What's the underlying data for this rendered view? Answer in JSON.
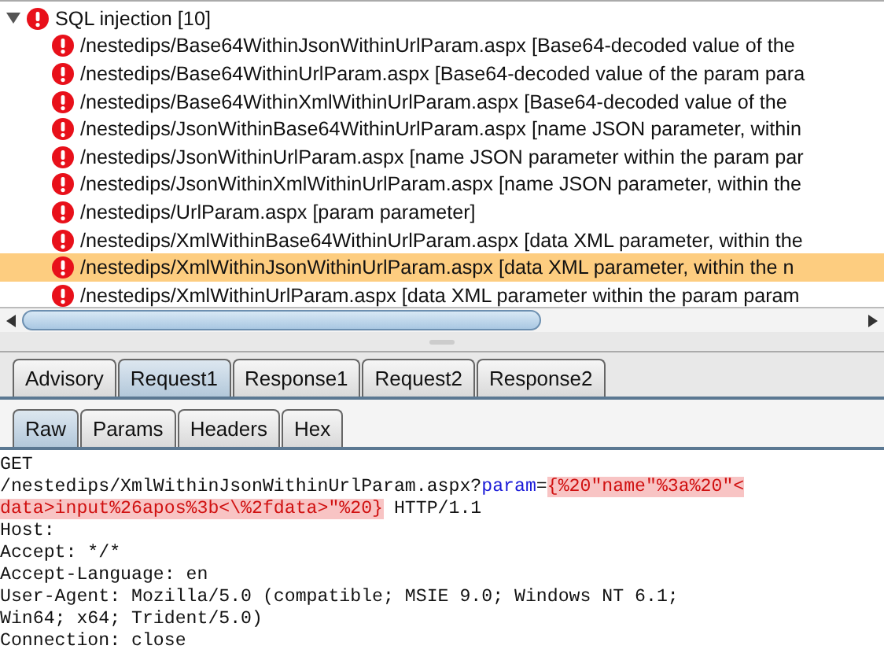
{
  "tree": {
    "label": "SQL injection [10]",
    "expanded": true,
    "children": [
      {
        "label": "/nestedips/Base64WithinJsonWithinUrlParam.aspx [Base64-decoded value of the",
        "selected": false
      },
      {
        "label": "/nestedips/Base64WithinUrlParam.aspx [Base64-decoded value of the param para",
        "selected": false
      },
      {
        "label": "/nestedips/Base64WithinXmlWithinUrlParam.aspx [Base64-decoded value of the",
        "selected": false
      },
      {
        "label": "/nestedips/JsonWithinBase64WithinUrlParam.aspx [name JSON parameter, within",
        "selected": false
      },
      {
        "label": "/nestedips/JsonWithinUrlParam.aspx [name JSON parameter within the param par",
        "selected": false
      },
      {
        "label": "/nestedips/JsonWithinXmlWithinUrlParam.aspx [name JSON parameter, within the",
        "selected": false
      },
      {
        "label": "/nestedips/UrlParam.aspx [param parameter]",
        "selected": false
      },
      {
        "label": "/nestedips/XmlWithinBase64WithinUrlParam.aspx [data XML parameter, within the",
        "selected": false
      },
      {
        "label": "/nestedips/XmlWithinJsonWithinUrlParam.aspx [data XML parameter, within the n",
        "selected": true
      },
      {
        "label": "/nestedips/XmlWithinUrlParam.aspx [data XML parameter within the param param",
        "selected": false
      }
    ]
  },
  "tabs": [
    {
      "label": "Advisory",
      "selected": false
    },
    {
      "label": "Request1",
      "selected": true
    },
    {
      "label": "Response1",
      "selected": false
    },
    {
      "label": "Request2",
      "selected": false
    },
    {
      "label": "Response2",
      "selected": false
    }
  ],
  "subtabs": [
    {
      "label": "Raw",
      "selected": true
    },
    {
      "label": "Params",
      "selected": false
    },
    {
      "label": "Headers",
      "selected": false
    },
    {
      "label": "Hex",
      "selected": false
    }
  ],
  "request_lines": [
    [
      {
        "text": "GET",
        "kind": "plain"
      }
    ],
    [
      {
        "text": "/nestedips/XmlWithinJsonWithinUrlParam.aspx?",
        "kind": "plain"
      },
      {
        "text": "param",
        "kind": "param"
      },
      {
        "text": "=",
        "kind": "plain"
      },
      {
        "text": "{%20\"name\"%3a%20\"<",
        "kind": "payload"
      }
    ],
    [
      {
        "text": "data>input%26apos%3b<\\%2fdata>\"%20}",
        "kind": "payload"
      },
      {
        "text": " HTTP/1.1",
        "kind": "plain"
      }
    ],
    [
      {
        "text": "Host:",
        "kind": "plain"
      }
    ],
    [
      {
        "text": "Accept: */*",
        "kind": "plain"
      }
    ],
    [
      {
        "text": "Accept-Language: en",
        "kind": "plain"
      }
    ],
    [
      {
        "text": "User-Agent: Mozilla/5.0 (compatible; MSIE 9.0; Windows NT 6.1;",
        "kind": "plain"
      }
    ],
    [
      {
        "text": "Win64; x64; Trident/5.0)",
        "kind": "plain"
      }
    ],
    [
      {
        "text": "Connection: close",
        "kind": "plain"
      }
    ]
  ]
}
